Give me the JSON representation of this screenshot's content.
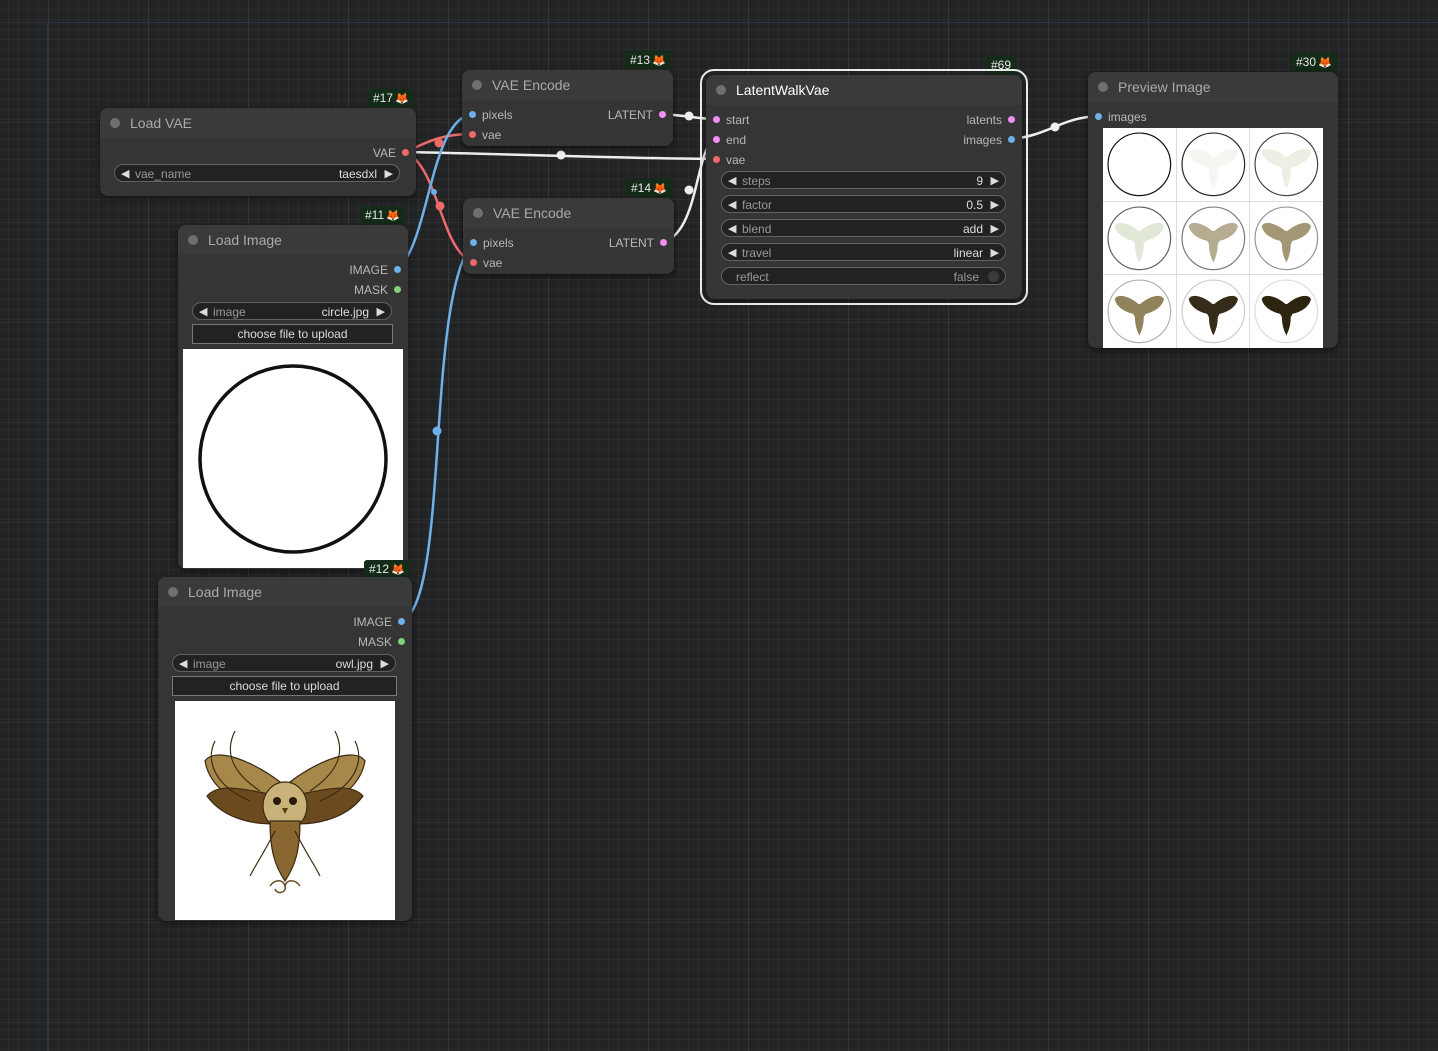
{
  "nodes": {
    "load_vae": {
      "id_badge": "#17",
      "title": "Load VAE",
      "outputs": [
        "VAE"
      ],
      "widgets": {
        "vae_name": {
          "label": "vae_name",
          "value": "taesdxl"
        }
      }
    },
    "load_image_circle": {
      "id_badge": "#11",
      "title": "Load Image",
      "outputs": [
        "IMAGE",
        "MASK"
      ],
      "widgets": {
        "image": {
          "label": "image",
          "value": "circle.jpg"
        }
      },
      "upload_button": "choose file to upload",
      "preview": "circle-outline"
    },
    "load_image_owl": {
      "id_badge": "#12",
      "title": "Load Image",
      "outputs": [
        "IMAGE",
        "MASK"
      ],
      "widgets": {
        "image": {
          "label": "image",
          "value": "owl.jpg"
        }
      },
      "upload_button": "choose file to upload",
      "preview": "ornamental-owl"
    },
    "vae_encode_13": {
      "id_badge": "#13",
      "title": "VAE Encode",
      "inputs": [
        "pixels",
        "vae"
      ],
      "outputs": [
        "LATENT"
      ]
    },
    "vae_encode_14": {
      "id_badge": "#14",
      "title": "VAE Encode",
      "inputs": [
        "pixels",
        "vae"
      ],
      "outputs": [
        "LATENT"
      ]
    },
    "latent_walk": {
      "id_badge": "#69",
      "title": "LatentWalkVae",
      "inputs": [
        "start",
        "end",
        "vae"
      ],
      "outputs": [
        "latents",
        "images"
      ],
      "widgets": {
        "steps": {
          "label": "steps",
          "value": "9"
        },
        "factor": {
          "label": "factor",
          "value": "0.5"
        },
        "blend": {
          "label": "blend",
          "value": "add"
        },
        "travel": {
          "label": "travel",
          "value": "linear"
        },
        "reflect": {
          "label": "reflect",
          "value": "false"
        }
      }
    },
    "preview_image": {
      "id_badge": "#30",
      "title": "Preview Image",
      "inputs": [
        "images"
      ],
      "grid_count": 9
    }
  },
  "slot_colors": {
    "IMAGE": "#6eb1ea",
    "VAE": "#ee6969",
    "LATENT": "#f28ef5",
    "MASK": "#7fd07f"
  }
}
